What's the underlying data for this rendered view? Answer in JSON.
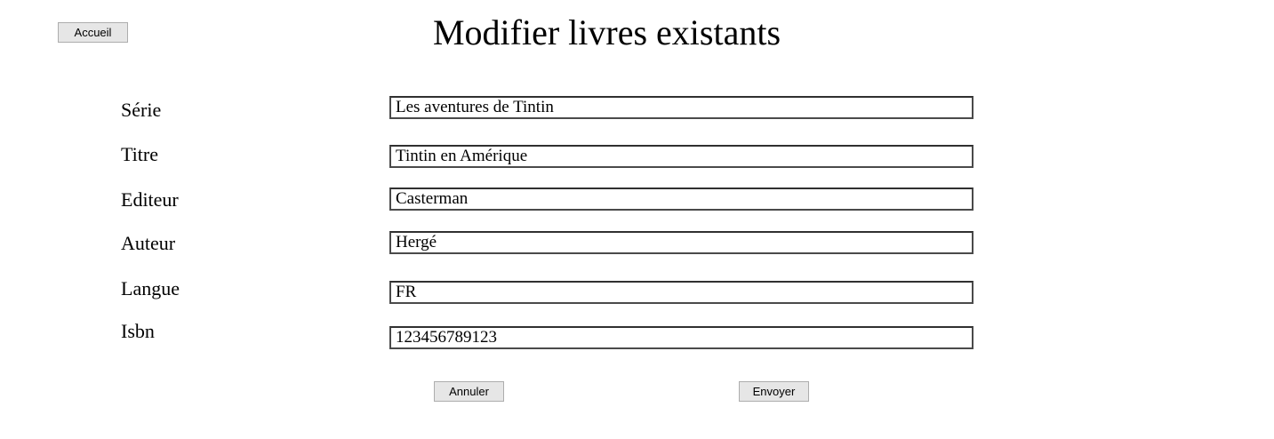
{
  "header": {
    "home_button": "Accueil",
    "title": "Modifier livres existants"
  },
  "form": {
    "fields": [
      {
        "label": "Série",
        "value": "Les aventures de Tintin"
      },
      {
        "label": "Titre",
        "value": "Tintin en Amérique"
      },
      {
        "label": "Editeur",
        "value": "Casterman"
      },
      {
        "label": "Auteur",
        "value": "Hergé"
      },
      {
        "label": "Langue",
        "value": "FR"
      },
      {
        "label": "Isbn",
        "value": "123456789123"
      }
    ],
    "cancel_button": "Annuler",
    "submit_button": "Envoyer"
  }
}
